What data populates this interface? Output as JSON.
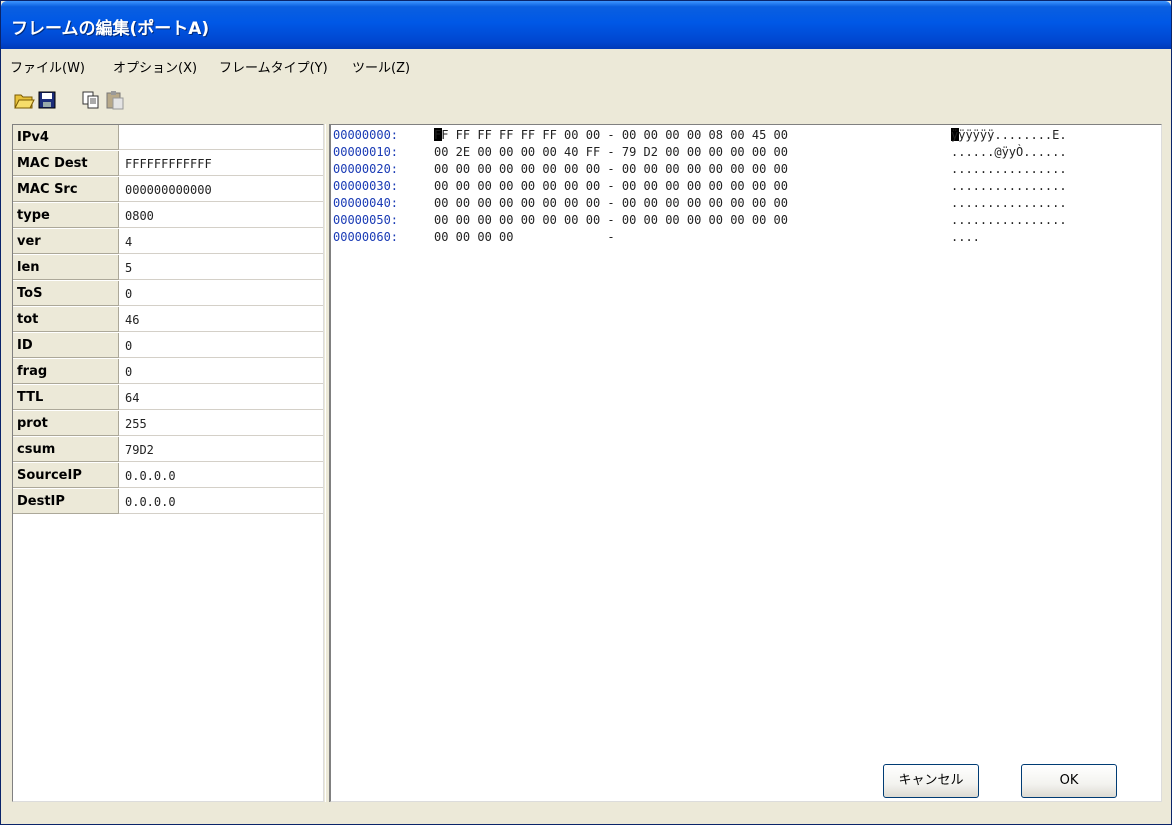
{
  "window": {
    "title": "フレームの編集(ポートA)"
  },
  "menu": [
    "ファイル(W)",
    "オプション(X)",
    "フレームタイプ(Y)",
    "ツール(Z)"
  ],
  "toolbar": {
    "icons": [
      "open-folder-icon",
      "save-disk-icon",
      "copy-icon",
      "paste-icon"
    ]
  },
  "properties": [
    {
      "key": "IPv4",
      "value": ""
    },
    {
      "key": "MAC Dest",
      "value": "FFFFFFFFFFFF"
    },
    {
      "key": "MAC Src",
      "value": "000000000000"
    },
    {
      "key": "type",
      "value": "0800"
    },
    {
      "key": "ver",
      "value": "4"
    },
    {
      "key": "len",
      "value": "5"
    },
    {
      "key": "ToS",
      "value": "0"
    },
    {
      "key": "tot",
      "value": "46"
    },
    {
      "key": "ID",
      "value": "0"
    },
    {
      "key": "frag",
      "value": "0"
    },
    {
      "key": "TTL",
      "value": "64"
    },
    {
      "key": "prot",
      "value": "255"
    },
    {
      "key": "csum",
      "value": "79D2"
    },
    {
      "key": "SourceIP",
      "value": "0.0.0.0"
    },
    {
      "key": "DestIP",
      "value": "0.0.0.0"
    }
  ],
  "hexdump": [
    {
      "addr": "00000000:",
      "bytes": "FF FF FF FF FF FF 00 00 - 00 00 00 00 08 00 45 00",
      "ascii": "ÿÿÿÿÿÿ........E."
    },
    {
      "addr": "00000010:",
      "bytes": "00 2E 00 00 00 00 40 FF - 79 D2 00 00 00 00 00 00",
      "ascii": "......@ÿyÒ......"
    },
    {
      "addr": "00000020:",
      "bytes": "00 00 00 00 00 00 00 00 - 00 00 00 00 00 00 00 00",
      "ascii": "................"
    },
    {
      "addr": "00000030:",
      "bytes": "00 00 00 00 00 00 00 00 - 00 00 00 00 00 00 00 00",
      "ascii": "................"
    },
    {
      "addr": "00000040:",
      "bytes": "00 00 00 00 00 00 00 00 - 00 00 00 00 00 00 00 00",
      "ascii": "................"
    },
    {
      "addr": "00000050:",
      "bytes": "00 00 00 00 00 00 00 00 - 00 00 00 00 00 00 00 00",
      "ascii": "................"
    },
    {
      "addr": "00000060:",
      "bytes": "00 00 00 00             -                        ",
      "ascii": "...."
    }
  ],
  "buttons": {
    "cancel": "キャンセル",
    "ok": "OK"
  },
  "colors": {
    "title_bar": "#0058e6",
    "address_text": "#1a3bb5",
    "face": "#ece9d8"
  }
}
